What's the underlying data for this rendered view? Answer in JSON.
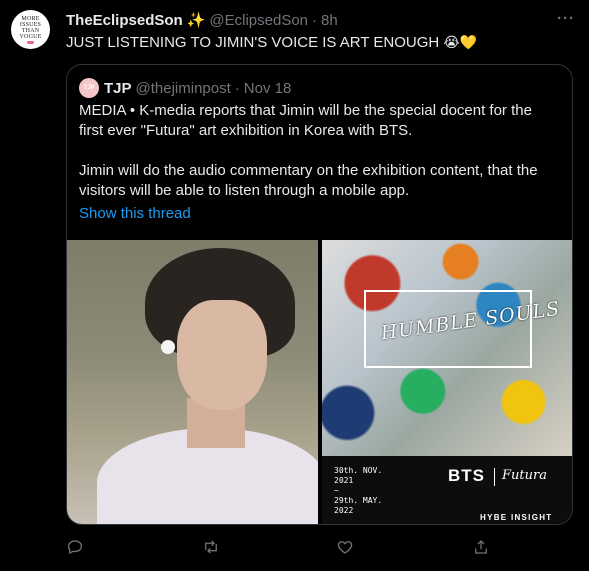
{
  "tweet": {
    "avatar_text": [
      "MORE",
      "ISSUES",
      "THAN",
      "VOGUE"
    ],
    "display_name": "TheEclipsedSon",
    "name_emoji": "✨",
    "handle": "@EclipsedSon",
    "separator": "·",
    "time": "8h",
    "more_label": "···",
    "text": "JUST LISTENING TO JIMIN'S VOICE IS ART ENOUGH",
    "text_emoji": "😭💛"
  },
  "quote": {
    "avatar_text": "TJP",
    "display_name": "TJP",
    "handle": "@thejiminpost",
    "separator": "·",
    "date": "Nov 18",
    "paragraph1": "MEDIA • K-media reports that Jimin will be the special docent for the first ever \"Futura\" art exhibition in Korea with BTS.",
    "paragraph2": "Jimin will do the audio commentary on the exhibition content, that the visitors will be able to listen through a mobile app.",
    "thread_link": "Show this thread",
    "link_color": "#1d9bf0",
    "poster": {
      "artwork_title": "HUMBLE SOULS",
      "date_lines": [
        "30th. NOV.",
        "2021",
        "~",
        "29th. MAY.",
        "2022"
      ],
      "brand": "BTS",
      "artist_signature": "Futura",
      "organizer": "HYBE INSIGHT"
    }
  },
  "actions": {
    "reply_icon": "reply-icon",
    "retweet_icon": "retweet-icon",
    "like_icon": "heart-icon",
    "share_icon": "share-icon"
  },
  "colors": {
    "background": "#000000",
    "text_primary": "#e7e9ea",
    "text_secondary": "#71767b",
    "border": "#2f3336"
  }
}
